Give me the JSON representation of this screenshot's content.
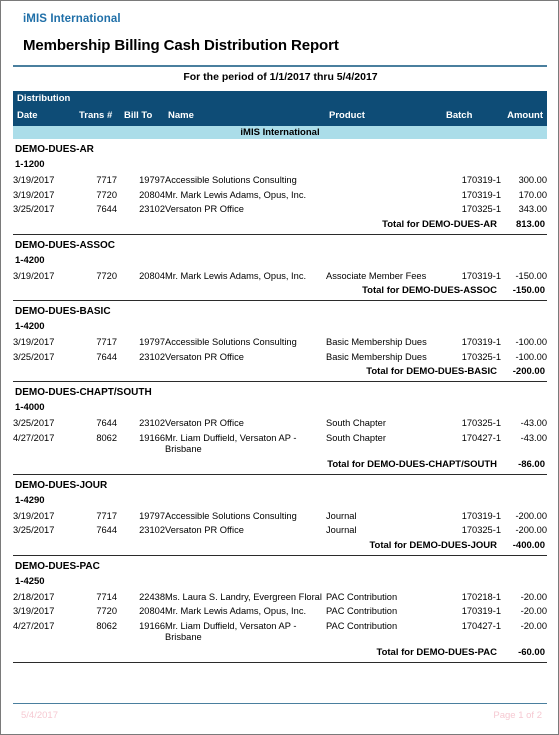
{
  "report": {
    "org_name": "iMIS International",
    "title": "Membership Billing Cash Distribution Report",
    "period": "For the period of 1/1/2017 thru 5/4/2017",
    "org_band": "iMIS International",
    "accent_color": "#1f6fa8",
    "header_bg": "#0e4c76",
    "band_bg": "#abdde9",
    "rule_color": "#4a7f9e",
    "footer_color": "#f6c9d2"
  },
  "table": {
    "section_label": "Distribution",
    "columns": {
      "date": "Date",
      "trans": "Trans #",
      "billto": "Bill To",
      "name": "Name",
      "product": "Product",
      "batch": "Batch",
      "amount": "Amount"
    }
  },
  "groups": [
    {
      "name": "DEMO-DUES-AR",
      "account": "1-1200",
      "rows": [
        {
          "date": "3/19/2017",
          "trans": "7717",
          "billto": "19797",
          "name": "Accessible Solutions Consulting",
          "product": "",
          "batch": "170319-1",
          "amount": "300.00"
        },
        {
          "date": "3/19/2017",
          "trans": "7720",
          "billto": "20804",
          "name": "Mr. Mark Lewis Adams, Opus, Inc.",
          "product": "",
          "batch": "170319-1",
          "amount": "170.00"
        },
        {
          "date": "3/25/2017",
          "trans": "7644",
          "billto": "23102",
          "name": "Versaton PR Office",
          "product": "",
          "batch": "170325-1",
          "amount": "343.00"
        }
      ],
      "total_label": "Total for DEMO-DUES-AR",
      "total_value": "813.00"
    },
    {
      "name": "DEMO-DUES-ASSOC",
      "account": "1-4200",
      "rows": [
        {
          "date": "3/19/2017",
          "trans": "7720",
          "billto": "20804",
          "name": "Mr. Mark Lewis Adams, Opus, Inc.",
          "product": "Associate Member Fees",
          "batch": "170319-1",
          "amount": "-150.00"
        }
      ],
      "total_label": "Total for DEMO-DUES-ASSOC",
      "total_value": "-150.00"
    },
    {
      "name": "DEMO-DUES-BASIC",
      "account": "1-4200",
      "rows": [
        {
          "date": "3/19/2017",
          "trans": "7717",
          "billto": "19797",
          "name": "Accessible Solutions Consulting",
          "product": "Basic Membership Dues",
          "batch": "170319-1",
          "amount": "-100.00"
        },
        {
          "date": "3/25/2017",
          "trans": "7644",
          "billto": "23102",
          "name": "Versaton PR Office",
          "product": "Basic Membership Dues",
          "batch": "170325-1",
          "amount": "-100.00"
        }
      ],
      "total_label": "Total for DEMO-DUES-BASIC",
      "total_value": "-200.00"
    },
    {
      "name": "DEMO-DUES-CHAPT/SOUTH",
      "account": "1-4000",
      "rows": [
        {
          "date": "3/25/2017",
          "trans": "7644",
          "billto": "23102",
          "name": "Versaton PR Office",
          "product": "South Chapter",
          "batch": "170325-1",
          "amount": "-43.00"
        },
        {
          "date": "4/27/2017",
          "trans": "8062",
          "billto": "19166",
          "name": "Mr. Liam Duffield, Versaton AP - Brisbane",
          "product": "South Chapter",
          "batch": "170427-1",
          "amount": "-43.00"
        }
      ],
      "total_label": "Total for DEMO-DUES-CHAPT/SOUTH",
      "total_value": "-86.00"
    },
    {
      "name": "DEMO-DUES-JOUR",
      "account": "1-4290",
      "rows": [
        {
          "date": "3/19/2017",
          "trans": "7717",
          "billto": "19797",
          "name": "Accessible Solutions Consulting",
          "product": "Journal",
          "batch": "170319-1",
          "amount": "-200.00"
        },
        {
          "date": "3/25/2017",
          "trans": "7644",
          "billto": "23102",
          "name": "Versaton PR Office",
          "product": "Journal",
          "batch": "170325-1",
          "amount": "-200.00"
        }
      ],
      "total_label": "Total for DEMO-DUES-JOUR",
      "total_value": "-400.00"
    },
    {
      "name": "DEMO-DUES-PAC",
      "account": "1-4250",
      "rows": [
        {
          "date": "2/18/2017",
          "trans": "7714",
          "billto": "22438",
          "name": "Ms. Laura S. Landry, Evergreen Floral",
          "product": "PAC Contribution",
          "batch": "170218-1",
          "amount": "-20.00"
        },
        {
          "date": "3/19/2017",
          "trans": "7720",
          "billto": "20804",
          "name": "Mr. Mark Lewis Adams, Opus, Inc.",
          "product": "PAC Contribution",
          "batch": "170319-1",
          "amount": "-20.00"
        },
        {
          "date": "4/27/2017",
          "trans": "8062",
          "billto": "19166",
          "name": "Mr. Liam Duffield, Versaton AP - Brisbane",
          "product": "PAC Contribution",
          "batch": "170427-1",
          "amount": "-20.00"
        }
      ],
      "total_label": "Total for DEMO-DUES-PAC",
      "total_value": "-60.00"
    }
  ],
  "footer": {
    "date": "5/4/2017",
    "page": "Page 1 of  2"
  }
}
